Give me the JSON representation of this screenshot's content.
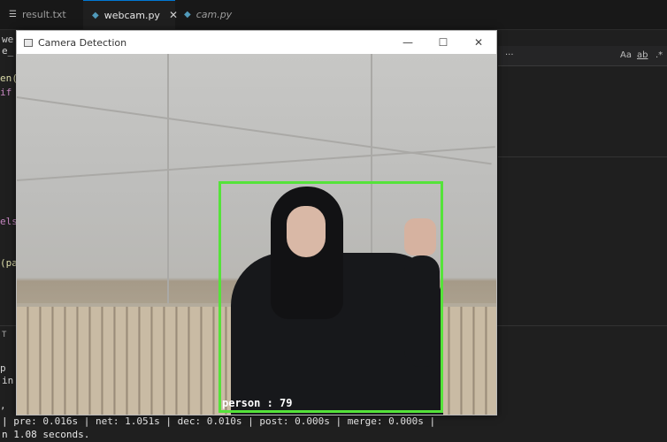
{
  "tabs": [
    {
      "label": "result.txt",
      "icon": "text-file-icon",
      "active": false,
      "italic": false
    },
    {
      "label": "webcam.py",
      "icon": "python-file-icon",
      "active": true,
      "italic": false
    },
    {
      "label": "cam.py",
      "icon": "python-file-icon",
      "active": false,
      "italic": true
    }
  ],
  "editor": {
    "fragments": [
      "we",
      "e_",
      "en(",
      "if",
      "els",
      "(pa",
      "T",
      "p",
      "in",
      "if",
      ","
    ],
    "find_bar": {
      "more": "···",
      "match_case": "Aa",
      "whole_word": "ab",
      "regex": ".*"
    }
  },
  "terminal": {
    "line1": "| pre: 0.016s | net: 1.051s | dec: 0.010s | post: 0.000s | merge: 0.000s |",
    "line2": "n 1.08 seconds."
  },
  "window": {
    "title": "Camera Detection",
    "minimize": "—",
    "maximize": "☐",
    "close": "✕"
  },
  "detection": {
    "label": "person : 79",
    "box_color": "#55e33a"
  }
}
